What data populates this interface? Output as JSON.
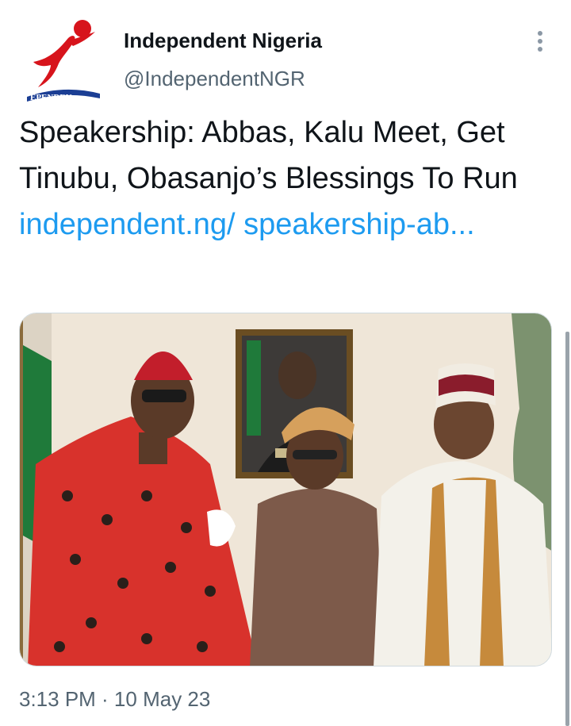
{
  "tweet": {
    "author_name": "Independent Nigeria",
    "author_handle": "@IndependentNGR",
    "avatar_logo_text": "INDEPENDENT",
    "text": "Speakership: Abbas, Kalu Meet, Get Tinubu, Obasanjo’s Blessings To Run ",
    "link": "independent.ng/ speakership-ab...",
    "timestamp": "3:13 PM · 10 May 23",
    "image_description": "Three men posing in front of a framed portrait and a Nigerian flag"
  },
  "colors": {
    "link": "#1d9bf0",
    "secondary_text": "#536471",
    "logo_red": "#d7141c",
    "logo_blue": "#1b3e94"
  },
  "icons": {
    "more": "more-vertical-icon"
  }
}
